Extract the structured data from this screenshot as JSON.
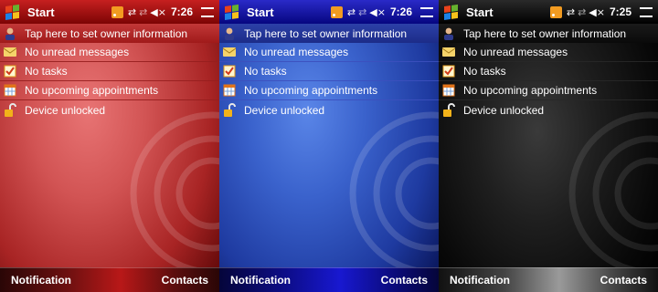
{
  "screens": [
    {
      "theme": "red",
      "title": "Start",
      "clock": "7:26",
      "today_items": [
        "Tap here to set owner information",
        "No unread messages",
        "No tasks",
        "No upcoming appointments",
        "Device unlocked"
      ],
      "softkeys": {
        "left": "Notification",
        "right": "Contacts"
      }
    },
    {
      "theme": "blue",
      "title": "Start",
      "clock": "7:26",
      "today_items": [
        "Tap here to set owner information",
        "No unread messages",
        "No tasks",
        "No upcoming appointments",
        "Device unlocked"
      ],
      "softkeys": {
        "left": "Notification",
        "right": "Contacts"
      }
    },
    {
      "theme": "black",
      "title": "Start",
      "clock": "7:25",
      "today_items": [
        "Tap here to set owner information",
        "No unread messages",
        "No tasks",
        "No upcoming appointments",
        "Device unlocked"
      ],
      "softkeys": {
        "left": "Notification",
        "right": "Contacts"
      }
    }
  ],
  "icons": {
    "titlebar": [
      "windows-start-flag-icon",
      "rss-feed-icon",
      "connectivity-arrows-icon",
      "signal-icon",
      "speaker-icon",
      "menu-icon"
    ],
    "today_rows": [
      "owner-info-icon",
      "messages-icon",
      "tasks-icon",
      "calendar-icon",
      "unlocked-padlock-icon"
    ]
  },
  "colors": {
    "flag": [
      "#e8421b",
      "#66b22e",
      "#1b82e8",
      "#f5c21b"
    ],
    "rss": "#f29b21"
  }
}
